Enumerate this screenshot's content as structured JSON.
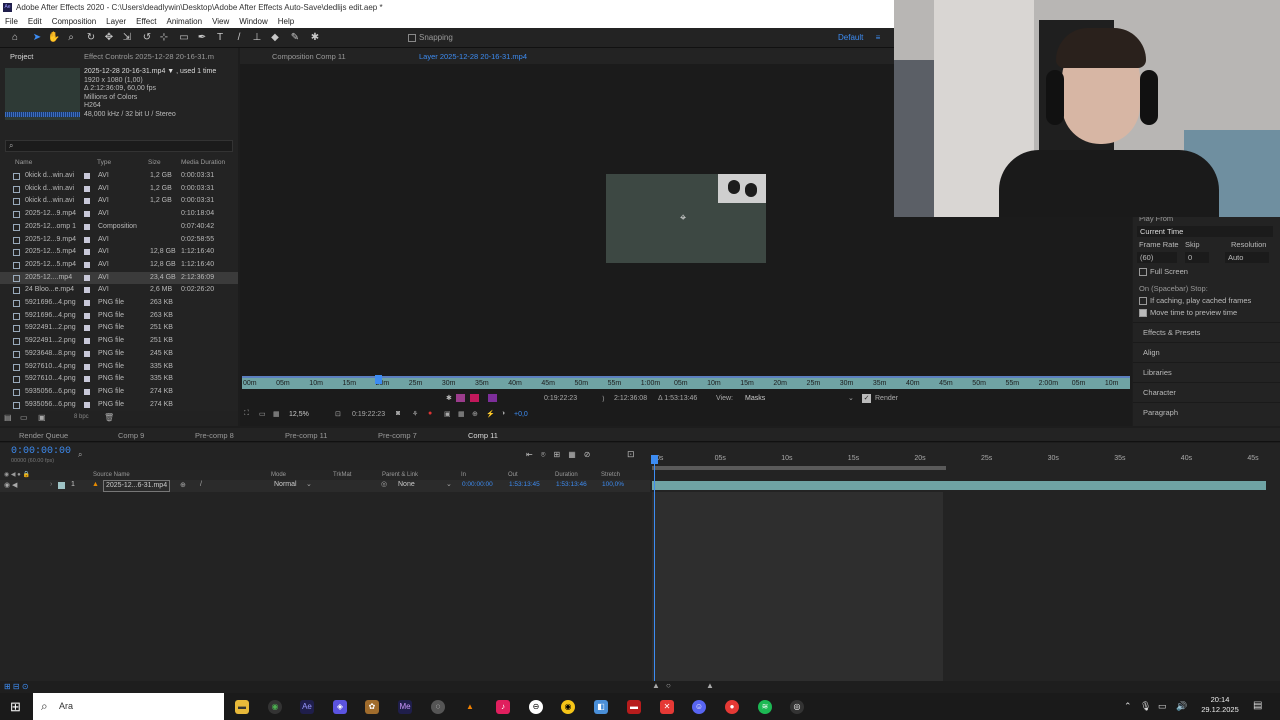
{
  "window": {
    "title": "Adobe After Effects 2020 - C:\\Users\\deadlywin\\Desktop\\Adobe After Effects Auto-Save\\dedlijs edit.aep *",
    "app_badge": "Ae"
  },
  "menu": [
    "File",
    "Edit",
    "Composition",
    "Layer",
    "Effect",
    "Animation",
    "View",
    "Window",
    "Help"
  ],
  "toolbar": {
    "snapping": "Snapping",
    "workspace": "Default"
  },
  "project": {
    "tab": "Project",
    "effect_tab": "Effect Controls 2025-12-28 20-16-31.m",
    "info": {
      "name": "2025-12-28 20-16-31.mp4 ▼ , used 1 time",
      "res": "1920 x 1080 (1,00)",
      "dur": "Δ 2:12:36:09, 60,00 fps",
      "colors": "Millions of Colors",
      "codec": "H264",
      "audio": "48,000 kHz / 32 bit U / Stereo"
    },
    "headers": {
      "name": "Name",
      "type": "Type",
      "size": "Size",
      "dur": "Media Duration"
    },
    "items": [
      {
        "name": "0kick d...win.avi",
        "type": "AVI",
        "size": "1,2 GB",
        "dur": "0:00:03:31"
      },
      {
        "name": "0kick d...win.avi",
        "type": "AVI",
        "size": "1,2 GB",
        "dur": "0:00:03:31"
      },
      {
        "name": "0kick d...win.avi",
        "type": "AVI",
        "size": "1,2 GB",
        "dur": "0:00:03:31"
      },
      {
        "name": "2025-12...9.mp4",
        "type": "AVI",
        "size": "",
        "dur": "0:10:18:04"
      },
      {
        "name": "2025-12...omp 1",
        "type": "Composition",
        "size": "",
        "dur": "0:07:40:42"
      },
      {
        "name": "2025-12...9.mp4",
        "type": "AVI",
        "size": "",
        "dur": "0:02:58:55"
      },
      {
        "name": "2025-12...5.mp4",
        "type": "AVI",
        "size": "12,8 GB",
        "dur": "1:12:16:40"
      },
      {
        "name": "2025-12...5.mp4",
        "type": "AVI",
        "size": "12,8 GB",
        "dur": "1:12:16:40"
      },
      {
        "name": "2025-12....mp4",
        "type": "AVI",
        "size": "23,4 GB",
        "dur": "2:12:36:09"
      },
      {
        "name": "24 Bloo...e.mp4",
        "type": "AVI",
        "size": "2,6 MB",
        "dur": "0:02:26:20"
      },
      {
        "name": "5921696...4.png",
        "type": "PNG file",
        "size": "263 KB",
        "dur": ""
      },
      {
        "name": "5921696...4.png",
        "type": "PNG file",
        "size": "263 KB",
        "dur": ""
      },
      {
        "name": "5922491...2.png",
        "type": "PNG file",
        "size": "251 KB",
        "dur": ""
      },
      {
        "name": "5922491...2.png",
        "type": "PNG file",
        "size": "251 KB",
        "dur": ""
      },
      {
        "name": "5923648...8.png",
        "type": "PNG file",
        "size": "245 KB",
        "dur": ""
      },
      {
        "name": "5927610...4.png",
        "type": "PNG file",
        "size": "335 KB",
        "dur": ""
      },
      {
        "name": "5927610...4.png",
        "type": "PNG file",
        "size": "335 KB",
        "dur": ""
      },
      {
        "name": "5935056...6.png",
        "type": "PNG file",
        "size": "274 KB",
        "dur": ""
      },
      {
        "name": "5935056...6.png",
        "type": "PNG file",
        "size": "274 KB",
        "dur": ""
      }
    ],
    "footer_bpc": "8 bpc"
  },
  "viewer": {
    "tab_comp": "Composition Comp 11",
    "tab_layer": "Layer 2025-12-28 20-16-31.mp4",
    "ruler_labels": [
      "00m",
      "05m",
      "10m",
      "15m",
      "20m",
      "25m",
      "30m",
      "35m",
      "40m",
      "45m",
      "50m",
      "55m",
      "1:00m",
      "05m",
      "10m",
      "15m",
      "20m",
      "25m",
      "30m",
      "35m",
      "40m",
      "45m",
      "50m",
      "55m",
      "2:00m",
      "05m",
      "10m"
    ],
    "in_time": "0:19:22:23",
    "out_time": "2:12:36:08",
    "duration": "Δ 1:53:13:46",
    "view_label": "View:",
    "view_value": "Masks",
    "render": "Render",
    "zoom": "12,5%",
    "current": "0:19:22:23",
    "exposure": "+0,0"
  },
  "preview": {
    "play_from": "Play From",
    "play_from_value": "Current Time",
    "frame_rate": "Frame Rate",
    "skip": "Skip",
    "resolution": "Resolution",
    "frame_rate_value": "(60)",
    "skip_value": "0",
    "resolution_value": "Auto",
    "full_screen": "Full Screen",
    "on_stop": "On (Spacebar) Stop:",
    "if_caching": "If caching, play cached frames",
    "move_time": "Move time to preview time",
    "sections": [
      "Effects & Presets",
      "Align",
      "Libraries",
      "Character",
      "Paragraph"
    ]
  },
  "timeline": {
    "tabs": [
      "Render Queue",
      "Comp 9",
      "Pre-comp 8",
      "Pre-comp 11",
      "Pre-comp 7",
      "Comp 11"
    ],
    "time": "0:00:00:00",
    "fps": "00000 (60.00 fps)",
    "col": {
      "source": "Source Name",
      "mode": "Mode",
      "trkmat": "TrkMat",
      "parent": "Parent & Link",
      "in": "In",
      "out": "Out",
      "duration": "Duration",
      "stretch": "Stretch"
    },
    "layer": {
      "num": "1",
      "name": "2025-12...6-31.mp4",
      "mode": "Normal",
      "parent": "None",
      "in": "0:00:00:00",
      "out": "1:53:13:45",
      "duration": "1:53:13:46",
      "stretch": "100,0%"
    },
    "ruler_labels": [
      "0s",
      "05s",
      "10s",
      "15s",
      "20s",
      "25s",
      "30s",
      "35s",
      "40s",
      "45s"
    ]
  },
  "taskbar": {
    "search": "Ara",
    "time": "20:14",
    "date": "29.12.2025"
  }
}
